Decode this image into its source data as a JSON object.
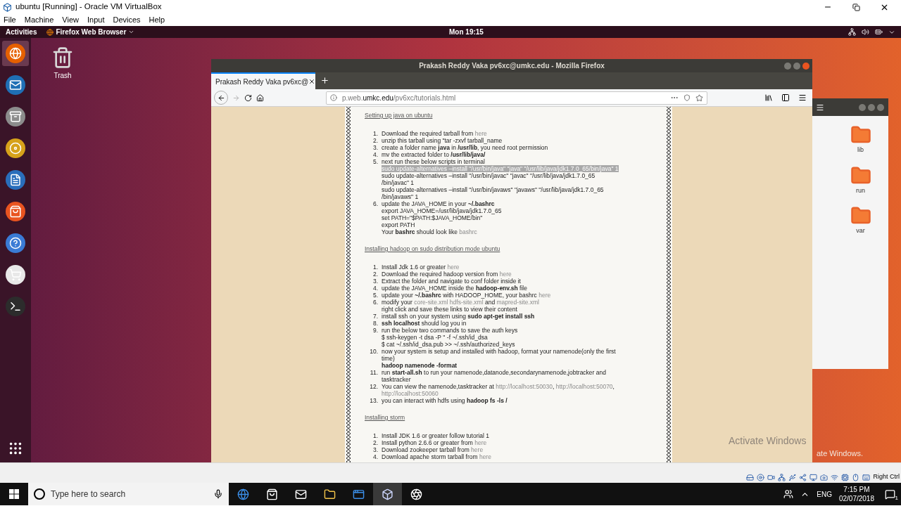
{
  "vbox": {
    "title": "ubuntu [Running] - Oracle VM VirtualBox",
    "menu": [
      "File",
      "Machine",
      "View",
      "Input",
      "Devices",
      "Help"
    ],
    "status_label": "Right Ctrl"
  },
  "ubuntu_bar": {
    "activities": "Activities",
    "app_menu": "Firefox Web Browser",
    "clock": "Mon 19:15"
  },
  "desktop_icons": [
    {
      "label": "Trash"
    }
  ],
  "firefox": {
    "title": "Prakash Reddy Vaka pv6xc@umkc.edu - Mozilla Firefox",
    "tab": "Prakash Reddy Vaka pv6xc@",
    "url_prefix": "p.web.",
    "url_domain": "umkc.edu",
    "url_path": "/pv6xc/tutorials.html",
    "sections": [
      {
        "heading": "Setting up java on ubuntu",
        "items": [
          {
            "number": "1.",
            "lines": [
              {
                "highlighted": false,
                "segments": [
                  {
                    "kind": "text",
                    "text": "Download the required tarball from "
                  },
                  {
                    "kind": "link",
                    "text": "here"
                  }
                ]
              }
            ]
          },
          {
            "number": "2.",
            "lines": [
              {
                "highlighted": false,
                "segments": [
                  {
                    "kind": "text",
                    "text": "unzip this tarball using \"tar -zxvf tarball_name"
                  }
                ]
              }
            ]
          },
          {
            "number": "3.",
            "lines": [
              {
                "highlighted": false,
                "segments": [
                  {
                    "kind": "text",
                    "text": "create a folder name "
                  },
                  {
                    "kind": "bold",
                    "text": "java"
                  },
                  {
                    "kind": "text",
                    "text": " in "
                  },
                  {
                    "kind": "bold",
                    "text": "/usr/lib"
                  },
                  {
                    "kind": "text",
                    "text": ", you need root permission"
                  }
                ]
              }
            ]
          },
          {
            "number": "4.",
            "lines": [
              {
                "highlighted": false,
                "segments": [
                  {
                    "kind": "text",
                    "text": "mv the extracted folder to "
                  },
                  {
                    "kind": "bold",
                    "text": "/usr/lib/java/"
                  }
                ]
              }
            ]
          },
          {
            "number": "5.",
            "lines": [
              {
                "highlighted": false,
                "segments": [
                  {
                    "kind": "text",
                    "text": "next run these below scripts in terminal"
                  }
                ]
              },
              {
                "highlighted": true,
                "segments": [
                  {
                    "kind": "text",
                    "text": "sudo update-alternatives –install \"/usr/bin/java\" \"java\" \"/usr/lib/java/jdk1.7.0_65/bin/java\" 1"
                  }
                ]
              },
              {
                "highlighted": false,
                "segments": [
                  {
                    "kind": "text",
                    "text": "sudo update-alternatives –install \"/usr/bin/javac\" \"javac\" \"/usr/lib/java/jdk1.7.0_65"
                  }
                ]
              },
              {
                "highlighted": false,
                "segments": [
                  {
                    "kind": "text",
                    "text": "/bin/javac\" 1"
                  }
                ]
              },
              {
                "highlighted": false,
                "segments": [
                  {
                    "kind": "text",
                    "text": "sudo update-alternatives –install \"/usr/bin/javaws\" \"javaws\" \"/usr/lib/java/jdk1.7.0_65"
                  }
                ]
              },
              {
                "highlighted": false,
                "segments": [
                  {
                    "kind": "text",
                    "text": "/bin/javaws\" 1"
                  }
                ]
              }
            ]
          },
          {
            "number": "6.",
            "lines": [
              {
                "highlighted": false,
                "segments": [
                  {
                    "kind": "text",
                    "text": "update the JAVA_HOME in your "
                  },
                  {
                    "kind": "bold",
                    "text": "~/.bashrc"
                  }
                ]
              },
              {
                "highlighted": false,
                "segments": [
                  {
                    "kind": "text",
                    "text": "export JAVA_HOME=/usr/lib/java/jdk1.7.0_65"
                  }
                ]
              },
              {
                "highlighted": false,
                "segments": [
                  {
                    "kind": "text",
                    "text": "set PATH=\"$PATH:$JAVA_HOME/bin\""
                  }
                ]
              },
              {
                "highlighted": false,
                "segments": [
                  {
                    "kind": "text",
                    "text": "export PATH"
                  }
                ]
              },
              {
                "highlighted": false,
                "segments": [
                  {
                    "kind": "text",
                    "text": "Your "
                  },
                  {
                    "kind": "bold",
                    "text": "bashrc"
                  },
                  {
                    "kind": "text",
                    "text": " should look like "
                  },
                  {
                    "kind": "link",
                    "text": "bashrc"
                  }
                ]
              }
            ]
          }
        ]
      },
      {
        "heading": "Installing hadoop on sudo distribution mode ubuntu",
        "items": [
          {
            "number": "1.",
            "lines": [
              {
                "highlighted": false,
                "segments": [
                  {
                    "kind": "text",
                    "text": "Install Jdk 1.6 or greater "
                  },
                  {
                    "kind": "link",
                    "text": "here"
                  }
                ]
              }
            ]
          },
          {
            "number": "2.",
            "lines": [
              {
                "highlighted": false,
                "segments": [
                  {
                    "kind": "text",
                    "text": "Download the required hadoop version from "
                  },
                  {
                    "kind": "link",
                    "text": "here"
                  }
                ]
              }
            ]
          },
          {
            "number": "3.",
            "lines": [
              {
                "highlighted": false,
                "segments": [
                  {
                    "kind": "text",
                    "text": "Extract the folder and navigate to conf folder inside it"
                  }
                ]
              }
            ]
          },
          {
            "number": "4.",
            "lines": [
              {
                "highlighted": false,
                "segments": [
                  {
                    "kind": "text",
                    "text": "update the JAVA_HOME inside the "
                  },
                  {
                    "kind": "bold",
                    "text": "hadoop-env.sh"
                  },
                  {
                    "kind": "text",
                    "text": " file"
                  }
                ]
              }
            ]
          },
          {
            "number": "5.",
            "lines": [
              {
                "highlighted": false,
                "segments": [
                  {
                    "kind": "text",
                    "text": "update your "
                  },
                  {
                    "kind": "bold",
                    "text": "~/.bashrc"
                  },
                  {
                    "kind": "text",
                    "text": " with HADOOP_HOME, your bashrc "
                  },
                  {
                    "kind": "link",
                    "text": "here"
                  }
                ]
              }
            ]
          },
          {
            "number": "6.",
            "lines": [
              {
                "highlighted": false,
                "segments": [
                  {
                    "kind": "text",
                    "text": "modify your "
                  },
                  {
                    "kind": "link",
                    "text": "core-site.xml"
                  },
                  {
                    "kind": "link",
                    "text": "hdfs-site.xml"
                  },
                  {
                    "kind": "text",
                    "text": " and "
                  },
                  {
                    "kind": "link",
                    "text": "mapred-site.xml"
                  }
                ]
              },
              {
                "highlighted": false,
                "segments": [
                  {
                    "kind": "text",
                    "text": "right click and save these links to view their content"
                  }
                ]
              }
            ]
          },
          {
            "number": "7.",
            "lines": [
              {
                "highlighted": false,
                "segments": [
                  {
                    "kind": "text",
                    "text": "install ssh on your system using "
                  },
                  {
                    "kind": "bold",
                    "text": "sudo apt-get install ssh"
                  }
                ]
              }
            ]
          },
          {
            "number": "8.",
            "lines": [
              {
                "highlighted": false,
                "segments": [
                  {
                    "kind": "bold",
                    "text": "ssh localhost"
                  },
                  {
                    "kind": "text",
                    "text": " should log you in"
                  }
                ]
              }
            ]
          },
          {
            "number": "9.",
            "lines": [
              {
                "highlighted": false,
                "segments": [
                  {
                    "kind": "text",
                    "text": "run the below two commands to save the auth keys"
                  }
                ]
              },
              {
                "highlighted": false,
                "segments": [
                  {
                    "kind": "text",
                    "text": "$ ssh-keygen -t dsa -P '' -f ~/.ssh/id_dsa"
                  }
                ]
              },
              {
                "highlighted": false,
                "segments": [
                  {
                    "kind": "text",
                    "text": "$ cat ~/.ssh/id_dsa.pub >> ~/.ssh/authorized_keys"
                  }
                ]
              }
            ]
          },
          {
            "number": "10.",
            "lines": [
              {
                "highlighted": false,
                "segments": [
                  {
                    "kind": "text",
                    "text": "now your system is setup and installed with hadoop, format your namenode(only the first"
                  }
                ]
              },
              {
                "highlighted": false,
                "segments": [
                  {
                    "kind": "text",
                    "text": "time)"
                  }
                ]
              },
              {
                "highlighted": false,
                "segments": [
                  {
                    "kind": "bold",
                    "text": "hadoop namenode -format"
                  }
                ]
              }
            ]
          },
          {
            "number": "11.",
            "lines": [
              {
                "highlighted": false,
                "segments": [
                  {
                    "kind": "text",
                    "text": "run "
                  },
                  {
                    "kind": "bold",
                    "text": "start-all.sh"
                  },
                  {
                    "kind": "text",
                    "text": " to run your namenode,datanode,secondarynamenode,jobtracker and"
                  }
                ]
              },
              {
                "highlighted": false,
                "segments": [
                  {
                    "kind": "text",
                    "text": "tasktracker"
                  }
                ]
              }
            ]
          },
          {
            "number": "12.",
            "lines": [
              {
                "highlighted": false,
                "segments": [
                  {
                    "kind": "text",
                    "text": "You can view the namenode,tasktracker at "
                  },
                  {
                    "kind": "link",
                    "text": "http://localhost:50030"
                  },
                  {
                    "kind": "text",
                    "text": ", "
                  },
                  {
                    "kind": "link",
                    "text": "http://localhost:50070"
                  },
                  {
                    "kind": "text",
                    "text": ","
                  }
                ]
              },
              {
                "highlighted": false,
                "segments": [
                  {
                    "kind": "link",
                    "text": "http://localhost:50060"
                  }
                ]
              }
            ]
          },
          {
            "number": "13.",
            "lines": [
              {
                "highlighted": false,
                "segments": [
                  {
                    "kind": "text",
                    "text": "you can interact with hdfs using "
                  },
                  {
                    "kind": "bold",
                    "text": "hadoop fs -ls /"
                  }
                ]
              }
            ]
          }
        ]
      },
      {
        "heading": "Installing storm",
        "items": [
          {
            "number": "1.",
            "lines": [
              {
                "highlighted": false,
                "segments": [
                  {
                    "kind": "text",
                    "text": "Install JDK 1.6 or greater follow tutorial 1"
                  }
                ]
              }
            ]
          },
          {
            "number": "2.",
            "lines": [
              {
                "highlighted": false,
                "segments": [
                  {
                    "kind": "text",
                    "text": "Install python 2.6.6 or greater from "
                  },
                  {
                    "kind": "link",
                    "text": "here"
                  }
                ]
              }
            ]
          },
          {
            "number": "3.",
            "lines": [
              {
                "highlighted": false,
                "segments": [
                  {
                    "kind": "text",
                    "text": "Download zookeeper tarball from "
                  },
                  {
                    "kind": "link",
                    "text": "here"
                  }
                ]
              }
            ]
          },
          {
            "number": "4.",
            "lines": [
              {
                "highlighted": false,
                "segments": [
                  {
                    "kind": "text",
                    "text": "Download apache storm tarball from "
                  },
                  {
                    "kind": "link",
                    "text": "here"
                  }
                ]
              }
            ]
          }
        ]
      }
    ]
  },
  "files_window": {
    "folders": [
      "lib",
      "run",
      "var"
    ]
  },
  "activation": [
    "Activate Windows",
    "ate Windows."
  ],
  "taskbar": {
    "search_placeholder": "Type here to search",
    "language": "ENG",
    "time": "7:15 PM",
    "date": "02/07/2018",
    "notifications": "1"
  }
}
